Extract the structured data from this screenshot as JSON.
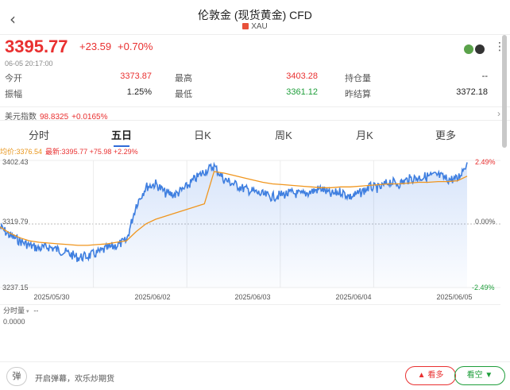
{
  "header": {
    "back_icon": "chevron-left-icon",
    "title": "伦敦金 (现货黄金) CFD",
    "subtitle": "XAU"
  },
  "quote": {
    "price": "3395.77",
    "change": "+23.59",
    "change_pct": "+0.70%",
    "time": "06-05 20:17:00",
    "price_color": "#e93030"
  },
  "stats": {
    "open_label": "今开",
    "open": "3373.87",
    "high_label": "最高",
    "high": "3403.28",
    "position_label": "持仓量",
    "position": "--",
    "amp_label": "振幅",
    "amp": "1.25%",
    "low_label": "最低",
    "low": "3361.12",
    "prev_label": "昨结算",
    "prev": "3372.18"
  },
  "usd": {
    "label": "美元指数",
    "value": "98.8325",
    "change": "+0.0165%"
  },
  "tabs": [
    "分时",
    "五日",
    "日K",
    "周K",
    "月K",
    "更多"
  ],
  "active_tab": "五日",
  "legend": {
    "avg": "均价:3376.54",
    "latest": "最新:3395.77 +75.98 +2.29%"
  },
  "chart_data": {
    "type": "line",
    "x_labels": [
      "2025/05/30",
      "2025/06/02",
      "2025/06/03",
      "2025/06/04",
      "2025/06/05"
    ],
    "y_labels": {
      "top": "3402.43",
      "mid": "3319.79",
      "bottom": "3237.15"
    },
    "pct_labels": {
      "top": "2.49%",
      "mid": "0.00%",
      "bottom": "-2.49%"
    },
    "ylim": [
      3237.15,
      3402.43
    ],
    "series": [
      {
        "name": "最新",
        "color": "#3f7fe0",
        "values": [
          3316,
          3305,
          3298,
          3292,
          3288,
          3290,
          3286,
          3282,
          3276,
          3278,
          3282,
          3288,
          3292,
          3298,
          3345,
          3368,
          3372,
          3360,
          3358,
          3366,
          3378,
          3388,
          3395,
          3378,
          3372,
          3366,
          3362,
          3358,
          3355,
          3358,
          3360,
          3358,
          3362,
          3366,
          3358,
          3362,
          3355,
          3360,
          3368,
          3366,
          3375,
          3372,
          3378,
          3380,
          3382,
          3383,
          3378,
          3378,
          3400
        ]
      },
      {
        "name": "均价",
        "color": "#f0961e",
        "values": [
          3316,
          3308,
          3302,
          3298,
          3296,
          3295,
          3294,
          3293,
          3292,
          3292,
          3293,
          3294,
          3296,
          3298,
          3310,
          3320,
          3326,
          3330,
          3334,
          3338,
          3342,
          3346,
          3388,
          3386,
          3383,
          3380,
          3377,
          3374,
          3372,
          3371,
          3370,
          3369,
          3368,
          3367,
          3367,
          3368,
          3368,
          3369,
          3370,
          3371,
          3372,
          3372,
          3373,
          3374,
          3374,
          3375,
          3375,
          3376,
          3382
        ]
      }
    ]
  },
  "volume": {
    "label": "分时量",
    "value_dash": "--",
    "zero": "0.0000"
  },
  "bottom": {
    "danmu_icon": "弹",
    "danmu_text": "开启弹幕，欢乐炒期货",
    "long": "看多",
    "short": "看空"
  }
}
